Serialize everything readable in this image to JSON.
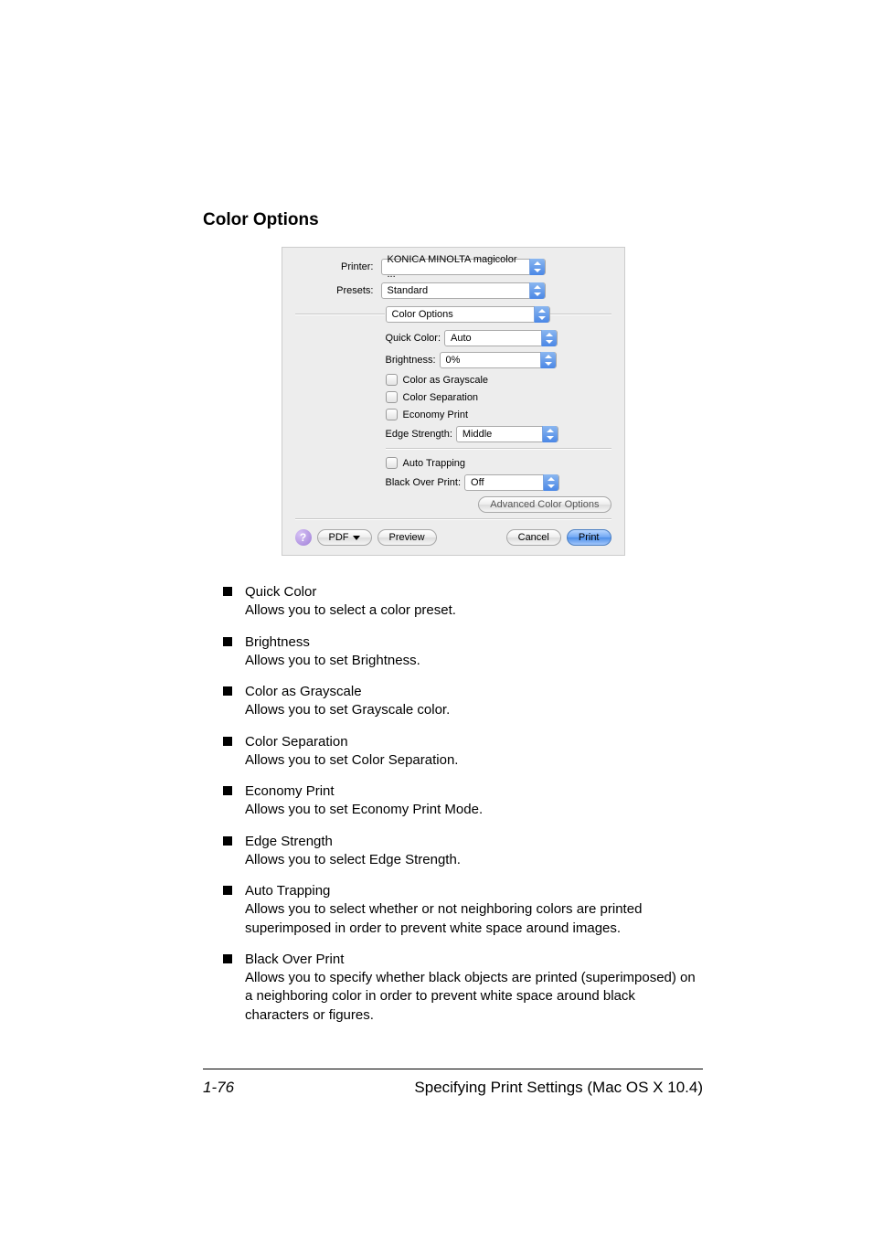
{
  "section_title": "Color Options",
  "dialog": {
    "printer_label": "Printer:",
    "printer_value": "KONICA MINOLTA magicolor ...",
    "presets_label": "Presets:",
    "presets_value": "Standard",
    "pane_value": "Color Options",
    "quick_color_label": "Quick Color:",
    "quick_color_value": "Auto",
    "brightness_label": "Brightness:",
    "brightness_value": "0%",
    "cb_grayscale": "Color as Grayscale",
    "cb_separation": "Color Separation",
    "cb_economy": "Economy Print",
    "edge_label": "Edge Strength:",
    "edge_value": "Middle",
    "cb_trapping": "Auto Trapping",
    "black_label": "Black Over Print:",
    "black_value": "Off",
    "advanced_btn": "Advanced Color Options",
    "help": "?",
    "pdf_btn": "PDF",
    "preview_btn": "Preview",
    "cancel_btn": "Cancel",
    "print_btn": "Print"
  },
  "features": [
    {
      "term": "Quick Color",
      "desc": "Allows you to select a color preset."
    },
    {
      "term": "Brightness",
      "desc": "Allows you to set Brightness."
    },
    {
      "term": "Color as Grayscale",
      "desc": "Allows you to set Grayscale color."
    },
    {
      "term": "Color Separation",
      "desc": "Allows you to set Color Separation."
    },
    {
      "term": "Economy Print",
      "desc": "Allows you to set Economy Print Mode."
    },
    {
      "term": "Edge Strength",
      "desc": "Allows you to select Edge Strength."
    },
    {
      "term": "Auto Trapping",
      "desc": "Allows you to select whether or not neighboring colors are printed superimposed in order to prevent white space around images."
    },
    {
      "term": "Black Over Print",
      "desc": "Allows you to specify whether black objects are printed (superimposed) on a neighboring color in order to prevent white space around black characters or figures."
    }
  ],
  "footer": {
    "page": "1-76",
    "title": "Specifying Print Settings (Mac OS X 10.4)"
  }
}
